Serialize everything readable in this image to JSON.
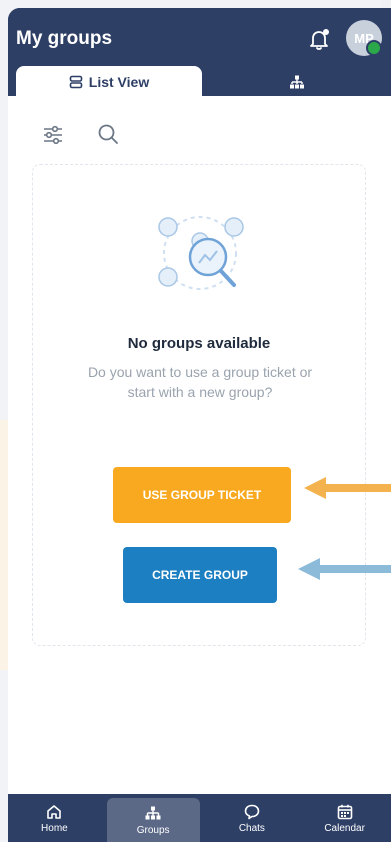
{
  "header": {
    "title": "My groups",
    "avatar_initials": "MP",
    "bell_icon": "notification-bell-icon"
  },
  "tabs": [
    {
      "label": "List View",
      "icon": "list-view-icon",
      "active": true
    },
    {
      "label": "",
      "icon": "hierarchy-icon",
      "active": false
    }
  ],
  "toolbar": {
    "filter_icon": "filter-sliders-icon",
    "search_icon": "search-icon"
  },
  "empty_state": {
    "title": "No groups available",
    "text": "Do you want to use a group ticket or start with a new group?",
    "illustration": "group-search-illustration"
  },
  "buttons": {
    "use_ticket": "USE GROUP TICKET",
    "create_group": "CREATE GROUP"
  },
  "bottom_nav": [
    {
      "label": "Home",
      "icon": "home-icon"
    },
    {
      "label": "Groups",
      "icon": "groups-icon",
      "active": true
    },
    {
      "label": "Chats",
      "icon": "chat-icon"
    },
    {
      "label": "Calendar",
      "icon": "calendar-icon"
    }
  ],
  "colors": {
    "header": "#2e3f66",
    "orange": "#f8a91f",
    "blue": "#1c7fc1",
    "arrow_orange": "#f4b24e",
    "arrow_blue": "#8cbbd9"
  }
}
